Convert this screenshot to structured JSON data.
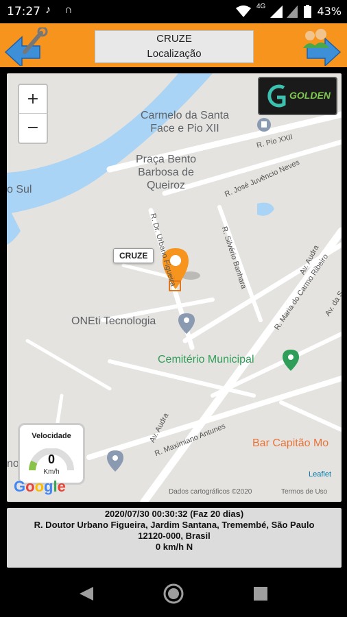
{
  "status_bar": {
    "time": "17:27",
    "network": "4G",
    "battery": "43%"
  },
  "header": {
    "vehicle": "CRUZE",
    "subtitle": "Localização"
  },
  "map": {
    "zoom_in": "+",
    "zoom_out": "−",
    "brand_logo": "GOLDEN",
    "places": {
      "carmelo": "Carmelo da Santa\nFace e Pio XII",
      "praca": "Praça Bento\nBarbosa de\nQueiroz",
      "oneti": "ONEti Tecnologia",
      "cemiterio": "Cemitério Municipal",
      "bar": "Bar Capitão Mo",
      "river": "o Sul",
      "tremembe": "no Tremembé"
    },
    "streets": {
      "pio": "R. Pio XXII",
      "juvencio": "R. José Juvêncio Neves",
      "urbano": "R. Dr. Urbano Figueira",
      "silverio": "R. Silvério Banhara",
      "audra1": "Av. Audra",
      "audra2": "Av. Audra",
      "maria": "R. Maria do Carmo Ribeiro",
      "avda": "Av. da S",
      "maximiano": "R. Maximiano Antunes"
    },
    "car_label": "CRUZE",
    "attribution": "Dados cartográficos ©2020",
    "terms": "Termos de Uso",
    "leaflet": "Leaflet",
    "google": "Google",
    "speed_gauge": {
      "title": "Velocidade",
      "value": "0",
      "unit": "Km/h"
    }
  },
  "info": {
    "datetime": "2020/07/30 00:30:32 (Faz 20 dias)",
    "address": "R. Doutor Urbano Figueira, Jardim Santana, Tremembé, São Paulo",
    "postal": "12120-000, Brasil",
    "speed": "0 km/h N"
  },
  "colors": {
    "accent": "#f7941d",
    "marker": "#f7941d",
    "river": "#a9d4f5",
    "park": "#2e9e58"
  }
}
